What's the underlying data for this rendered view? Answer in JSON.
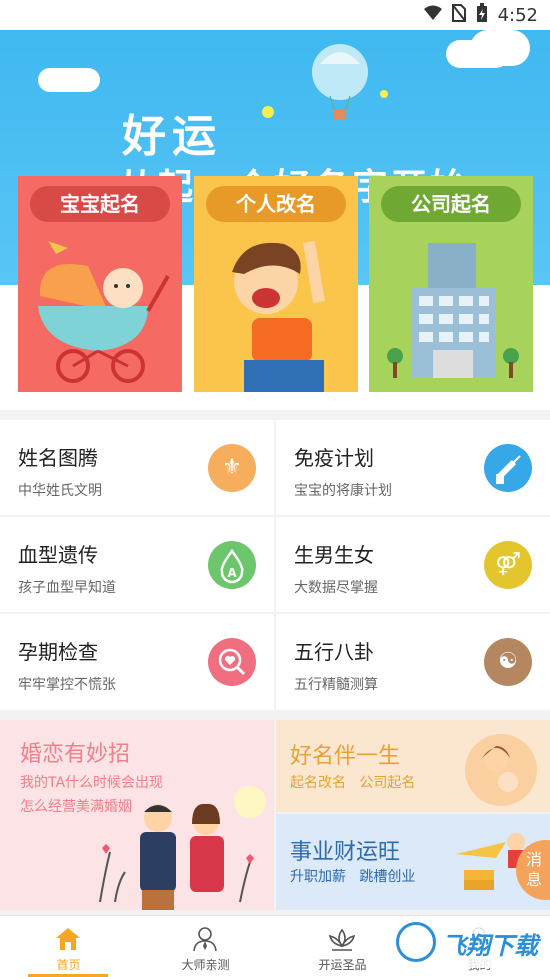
{
  "statusbar": {
    "time": "4:52"
  },
  "hero": {
    "title": "好运",
    "subtitle": "从起一个好名字开始",
    "cards": [
      {
        "label": "宝宝起名",
        "color": "#f56a62"
      },
      {
        "label": "个人改名",
        "color": "#fbc44a"
      },
      {
        "label": "公司起名",
        "color": "#a7d25c"
      }
    ]
  },
  "grid": [
    {
      "title": "姓名图腾",
      "subtitle": "中华姓氏文明",
      "icon": "fleur-de-lis-icon",
      "color": "#f6ae5d"
    },
    {
      "title": "免疫计划",
      "subtitle": "宝宝的将康计划",
      "icon": "syringe-icon",
      "color": "#36a8e8"
    },
    {
      "title": "血型遗传",
      "subtitle": "孩子血型早知道",
      "icon": "blood-drop-icon",
      "color": "#6cc66b"
    },
    {
      "title": "生男生女",
      "subtitle": "大数据尽掌握",
      "icon": "gender-icon",
      "color": "#e3c62e"
    },
    {
      "title": "孕期检查",
      "subtitle": "牢牢掌控不慌张",
      "icon": "search-heart-icon",
      "color": "#ef6f81"
    },
    {
      "title": "五行八卦",
      "subtitle": "五行精髓测算",
      "icon": "bagua-icon",
      "color": "#b48761"
    }
  ],
  "promos": {
    "left": {
      "title": "婚恋有妙招",
      "line1": "我的TA什么时候会出现",
      "line2": "怎么经营美满婚姻"
    },
    "right_top": {
      "title": "好名伴一生",
      "subtitle": "起名改名   公司起名"
    },
    "right_bottom": {
      "title": "事业财运旺",
      "subtitle": "升职加薪   跳槽创业"
    }
  },
  "message_button": "消息",
  "tabs": [
    {
      "label": "首页",
      "icon": "home-icon",
      "active": true
    },
    {
      "label": "大师亲测",
      "icon": "master-icon",
      "active": false
    },
    {
      "label": "开运圣品",
      "icon": "lotus-icon",
      "active": false
    },
    {
      "label": "我的",
      "icon": "profile-icon",
      "active": false
    }
  ],
  "watermark": "飞翔下载",
  "colors": {
    "accent": "#f6a623",
    "hero_bg": "#4fc0f2"
  }
}
